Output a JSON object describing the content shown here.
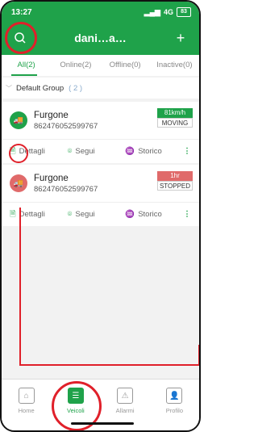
{
  "status": {
    "time": "13:27",
    "network": "4G",
    "battery": "83"
  },
  "header": {
    "title": "dani…a…"
  },
  "tabs": [
    {
      "label": "All(2)"
    },
    {
      "label": "Online(2)"
    },
    {
      "label": "Offline(0)"
    },
    {
      "label": "Inactive(0)"
    }
  ],
  "group": {
    "name": "Default Group",
    "count": "( 2 )"
  },
  "vehicles": [
    {
      "name": "Furgone",
      "id": "862476052599767",
      "badge_top": "81km/h",
      "badge_bottom": "MOVING",
      "color": "#1fa24a",
      "actions": {
        "details": "Dettagli",
        "follow": "Segui",
        "history": "Storico"
      }
    },
    {
      "name": "Furgone",
      "id": "862476052599767",
      "badge_top": "1hr",
      "badge_bottom": "STOPPED",
      "color": "#e06a6a",
      "actions": {
        "details": "Dettagli",
        "follow": "Segui",
        "history": "Storico"
      }
    }
  ],
  "bottom_nav": [
    {
      "label": "Home",
      "icon": "home-icon"
    },
    {
      "label": "Veicoli",
      "icon": "vehicles-icon"
    },
    {
      "label": "Allarmi",
      "icon": "alarm-icon"
    },
    {
      "label": "Profilo",
      "icon": "profile-icon"
    }
  ],
  "colors": {
    "brand": "#1fa24a",
    "moving": "#1fa24a",
    "stopped": "#e06a6a",
    "annotation": "#e0202a"
  }
}
